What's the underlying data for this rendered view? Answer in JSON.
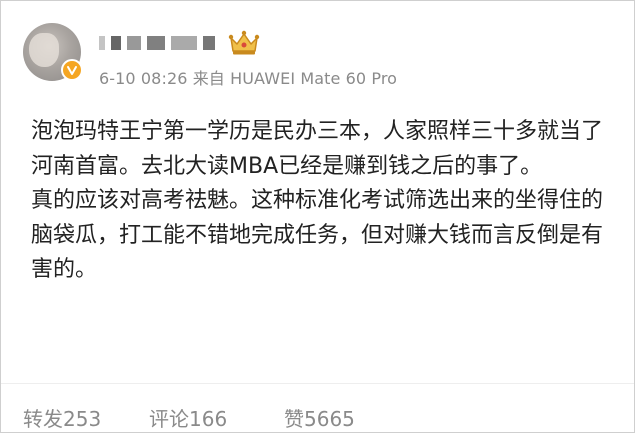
{
  "post": {
    "author": {
      "avatar_icon": "avatar-photo",
      "verified_icon": "verified-v-icon",
      "badge_icon": "crown-badge-icon",
      "brand_colors": {
        "badge": "#f5a623",
        "crown": "#e3a334"
      }
    },
    "meta": "6-10 08:26 来自 HUAWEI Mate 60 Pro",
    "content": [
      "泡泡玛特王宁第一学历是民办三本，人家照样三十多就当了河南首富。去北大读MBA已经是赚到钱之后的事了。",
      "真的应该对高考祛魅。这种标准化考试筛选出来的坐得住的脑袋瓜，打工能不错地完成任务，但对赚大钱而言反倒是有害的。"
    ],
    "actions": {
      "repost": "转发253",
      "comment": "评论166",
      "like": "赞5665"
    }
  }
}
